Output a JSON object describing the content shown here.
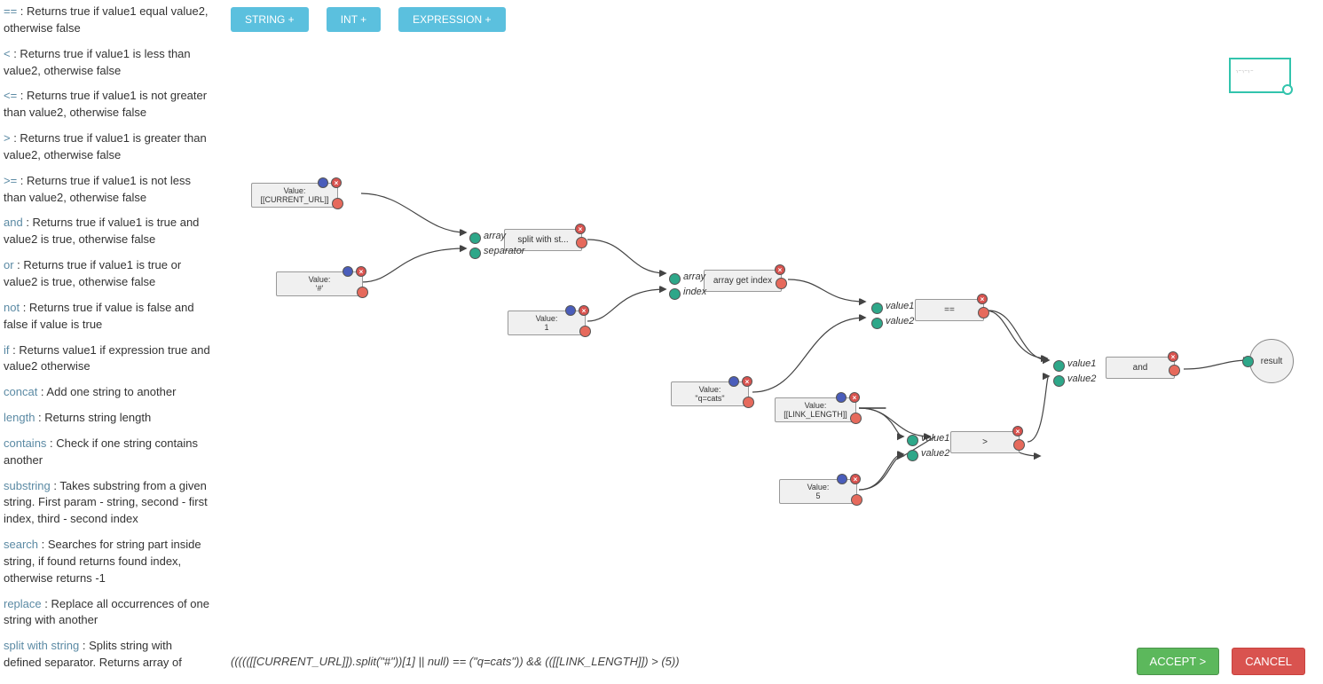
{
  "sidebar": {
    "items": [
      {
        "kw": "==",
        "desc": " : Returns true if value1 equal value2, otherwise false"
      },
      {
        "kw": "<",
        "desc": " : Returns true if value1 is less than value2, otherwise false"
      },
      {
        "kw": "<=",
        "desc": " : Returns true if value1 is not greater than value2, otherwise false"
      },
      {
        "kw": ">",
        "desc": " : Returns true if value1 is greater than value2, otherwise false"
      },
      {
        "kw": ">=",
        "desc": " : Returns true if value1 is not less than value2, otherwise false"
      },
      {
        "kw": "and",
        "desc": " : Returns true if value1 is true and value2 is true, otherwise false"
      },
      {
        "kw": "or",
        "desc": " : Returns true if value1 is true or value2 is true, otherwise false"
      },
      {
        "kw": "not",
        "desc": " : Returns true if value is false and false if value is true"
      },
      {
        "kw": "if",
        "desc": " : Returns value1 if expression true and value2 otherwise"
      },
      {
        "kw": "concat",
        "desc": " : Add one string to another"
      },
      {
        "kw": "length",
        "desc": " : Returns string length"
      },
      {
        "kw": "contains",
        "desc": " : Check if one string contains another"
      },
      {
        "kw": "substring",
        "desc": " : Takes substring from a given string. First param - string, second - first index, third - second index"
      },
      {
        "kw": "search",
        "desc": " : Searches for string part inside string, if found returns found index, otherwise returns -1"
      },
      {
        "kw": "replace",
        "desc": " : Replace all occurrences of one string with another"
      },
      {
        "kw": "split with string",
        "desc": " : Splits string with defined separator. Returns array of"
      }
    ]
  },
  "toolbar": {
    "string_btn": "STRING +",
    "int_btn": "INT +",
    "expr_btn": "EXPRESSION +"
  },
  "nodes": {
    "current_url": {
      "label": "Value:",
      "value": "[[CURRENT_URL]]"
    },
    "hash": {
      "label": "Value:",
      "value": "'#'"
    },
    "split": {
      "label": "split with st..."
    },
    "split_ports": {
      "array": "array",
      "separator": "separator"
    },
    "one": {
      "label": "Value:",
      "value": "1"
    },
    "get_index": {
      "label": "array get index"
    },
    "get_index_ports": {
      "array": "array",
      "index": "index"
    },
    "qcats": {
      "label": "Value:",
      "value": "\"q=cats\""
    },
    "eq": {
      "label": "=="
    },
    "eq_ports": {
      "value1": "value1",
      "value2": "value2"
    },
    "link_len": {
      "label": "Value:",
      "value": "[[LINK_LENGTH]]"
    },
    "five": {
      "label": "Value:",
      "value": "5"
    },
    "gt": {
      "label": ">"
    },
    "gt_ports": {
      "value1": "value1",
      "value2": "value2"
    },
    "and": {
      "label": "and"
    },
    "and_ports": {
      "value1": "value1",
      "value2": "value2"
    },
    "result": {
      "label": "result"
    }
  },
  "footer": {
    "expression": "((((([[CURRENT_URL]]).split(\"#\"))[1] || null) == (\"q=cats\")) && (([[LINK_LENGTH]]) > (5))",
    "accept": "ACCEPT >",
    "cancel": "CANCEL"
  },
  "minimap_preview": "┐─ ┐─ ┐─"
}
